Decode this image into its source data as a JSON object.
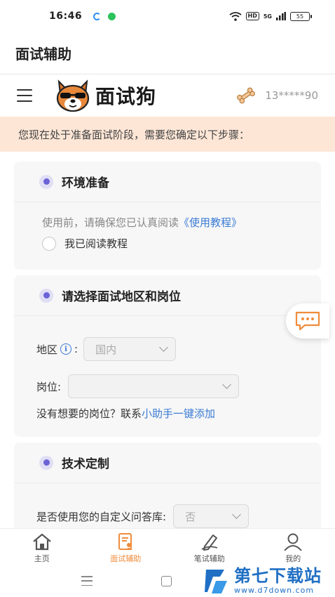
{
  "status_bar": {
    "time": "16:46",
    "network": "5G",
    "hd": "HD",
    "battery": "55"
  },
  "app": {
    "title": "面试辅助"
  },
  "header": {
    "brand": "面试狗",
    "phone": "13*****90"
  },
  "notice": "您现在处于准备面试阶段，需要您确定以下步骤：",
  "section_env": {
    "title": "环境准备",
    "instruction_prefix": "使用前，请确保您已认真阅读",
    "tutorial_link": "《使用教程》",
    "checkbox_label": "我已阅读教程"
  },
  "section_region": {
    "title": "请选择面试地区和岗位",
    "region_label": "地区",
    "region_value": "国内",
    "position_label": "岗位:",
    "position_value": "",
    "help_prefix": "没有想要的岗位？联系",
    "help_link": "小助手一键添加"
  },
  "section_tech": {
    "title": "技术定制",
    "question_label": "是否使用您的自定义问答库:",
    "question_value": "否"
  },
  "tabs": [
    {
      "label": "主页"
    },
    {
      "label": "面试辅助"
    },
    {
      "label": "笔试辅助"
    },
    {
      "label": "我的"
    }
  ],
  "watermark": {
    "title": "第七下载站",
    "url": "www.d7down.com"
  },
  "colors": {
    "accent": "#f08c3b",
    "link": "#3a7bd5",
    "bullet": "#6b62d6",
    "notice_bg": "#fde6d6"
  }
}
